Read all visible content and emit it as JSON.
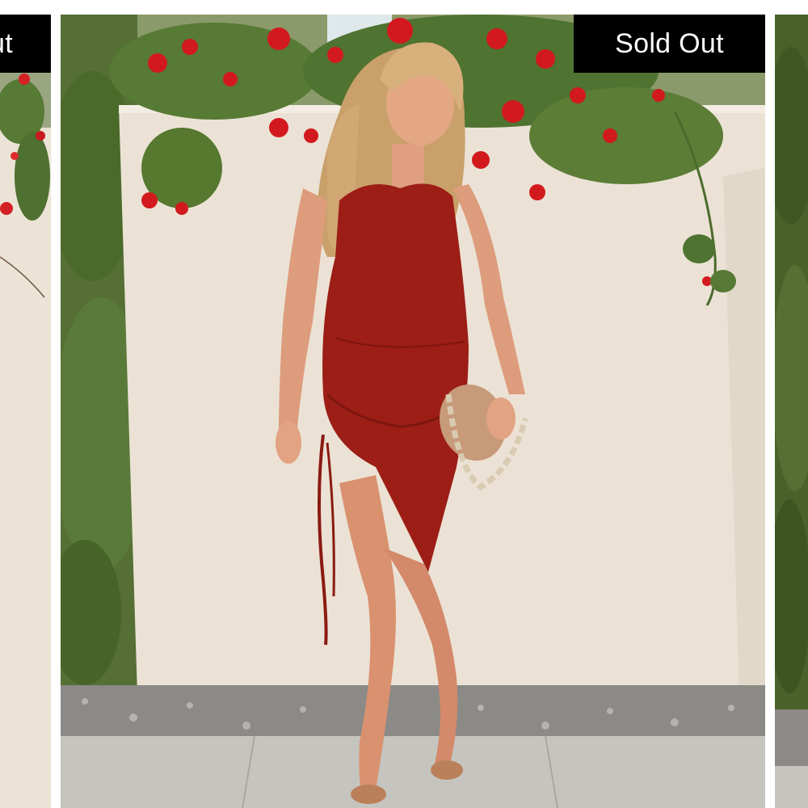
{
  "carousel": {
    "prev_slide": {
      "badge": "Sold Out"
    },
    "current_slide": {
      "badge": "Sold Out",
      "image_subject": "product-photo"
    },
    "next_slide": {}
  },
  "colors": {
    "badge_bg": "#000000",
    "badge_text": "#ffffff",
    "dress": "#9c1e16",
    "wall": "#e9e0d4",
    "flowers": "#d21a1e",
    "foliage": "#4f6f2c"
  }
}
